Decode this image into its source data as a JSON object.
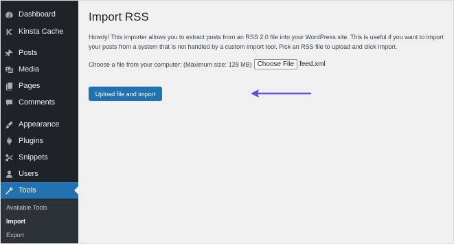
{
  "sidebar": {
    "items": [
      {
        "label": "Dashboard",
        "icon": "dashboard-icon"
      },
      {
        "label": "Kinsta Cache",
        "icon": "kinsta-icon"
      },
      {
        "label": "Posts",
        "icon": "pushpin-icon"
      },
      {
        "label": "Media",
        "icon": "media-icon"
      },
      {
        "label": "Pages",
        "icon": "pages-icon"
      },
      {
        "label": "Comments",
        "icon": "comment-icon"
      },
      {
        "label": "Appearance",
        "icon": "brush-icon"
      },
      {
        "label": "Plugins",
        "icon": "plugin-icon"
      },
      {
        "label": "Snippets",
        "icon": "snippets-icon"
      },
      {
        "label": "Users",
        "icon": "users-icon"
      },
      {
        "label": "Tools",
        "icon": "wrench-icon",
        "active": true
      }
    ],
    "submenu": [
      {
        "label": "Available Tools"
      },
      {
        "label": "Import",
        "current": true
      },
      {
        "label": "Export"
      }
    ]
  },
  "main": {
    "title": "Import RSS",
    "intro": "Howdy! This importer allows you to extract posts from an RSS 2.0 file into your WordPress site. This is useful if you want to import your posts from a system that is not handled by a custom import tool. Pick an RSS file to upload and click Import.",
    "file_label": "Choose a file from your computer: (Maximum size: 128 MB)",
    "choose_button": "Choose File",
    "file_name": "feed.xml",
    "upload_button": "Upload file and import"
  },
  "colors": {
    "sidebar_bg": "#1d2327",
    "accent": "#2271b1",
    "annotation_arrow": "#5b4fe0"
  }
}
